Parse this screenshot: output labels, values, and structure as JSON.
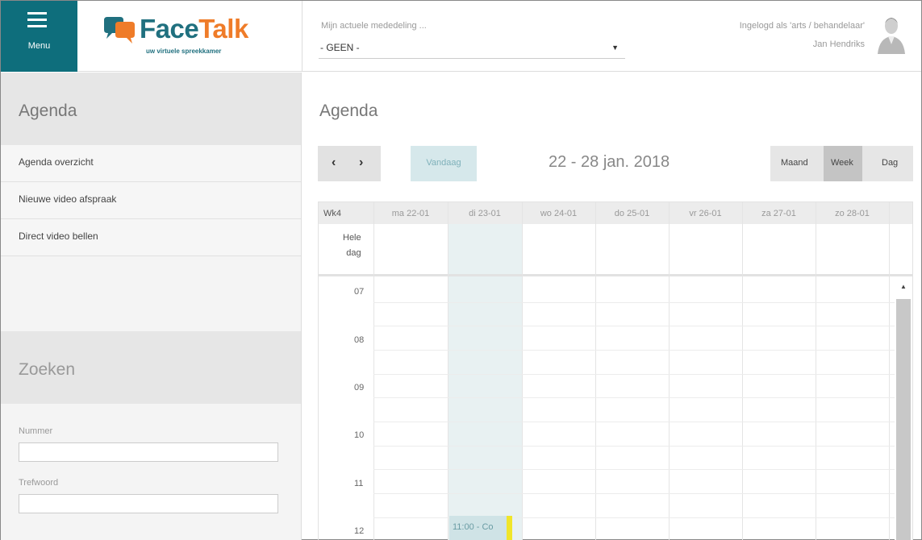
{
  "header": {
    "menu_label": "Menu",
    "brand_face": "Face",
    "brand_talk": "Talk",
    "tagline": "uw virtuele spreekkamer",
    "announcement_label": "Mijn actuele mededeling ...",
    "announcement_value": "- GEEN -",
    "user_role": "Ingelogd als 'arts / behandelaar'",
    "user_name": "Jan Hendriks"
  },
  "sidebar": {
    "agenda_title": "Agenda",
    "items": [
      {
        "label": "Agenda overzicht"
      },
      {
        "label": "Nieuwe video afspraak"
      },
      {
        "label": "Direct video bellen"
      }
    ],
    "search_title": "Zoeken",
    "number_label": "Nummer",
    "keyword_label": "Trefwoord"
  },
  "main": {
    "title": "Agenda",
    "prev": "‹",
    "next": "›",
    "today_label": "Vandaag",
    "date_range": "22 - 28 jan. 2018",
    "views": {
      "month": "Maand",
      "week": "Week",
      "day": "Dag"
    }
  },
  "calendar": {
    "week_label": "Wk4",
    "days": [
      "ma 22-01",
      "di 23-01",
      "wo 24-01",
      "do 25-01",
      "vr 26-01",
      "za 27-01",
      "zo 28-01"
    ],
    "allday_line1": "Hele",
    "allday_line2": "dag",
    "hours": [
      "07",
      "08",
      "09",
      "10",
      "11",
      "12"
    ],
    "event_text": "11:00 - Co",
    "colors": {
      "accent": "#0e6e7c",
      "brand_orange": "#ef7c29",
      "today_bg": "#e8f1f2",
      "event_marker": "#f0e52a"
    }
  }
}
